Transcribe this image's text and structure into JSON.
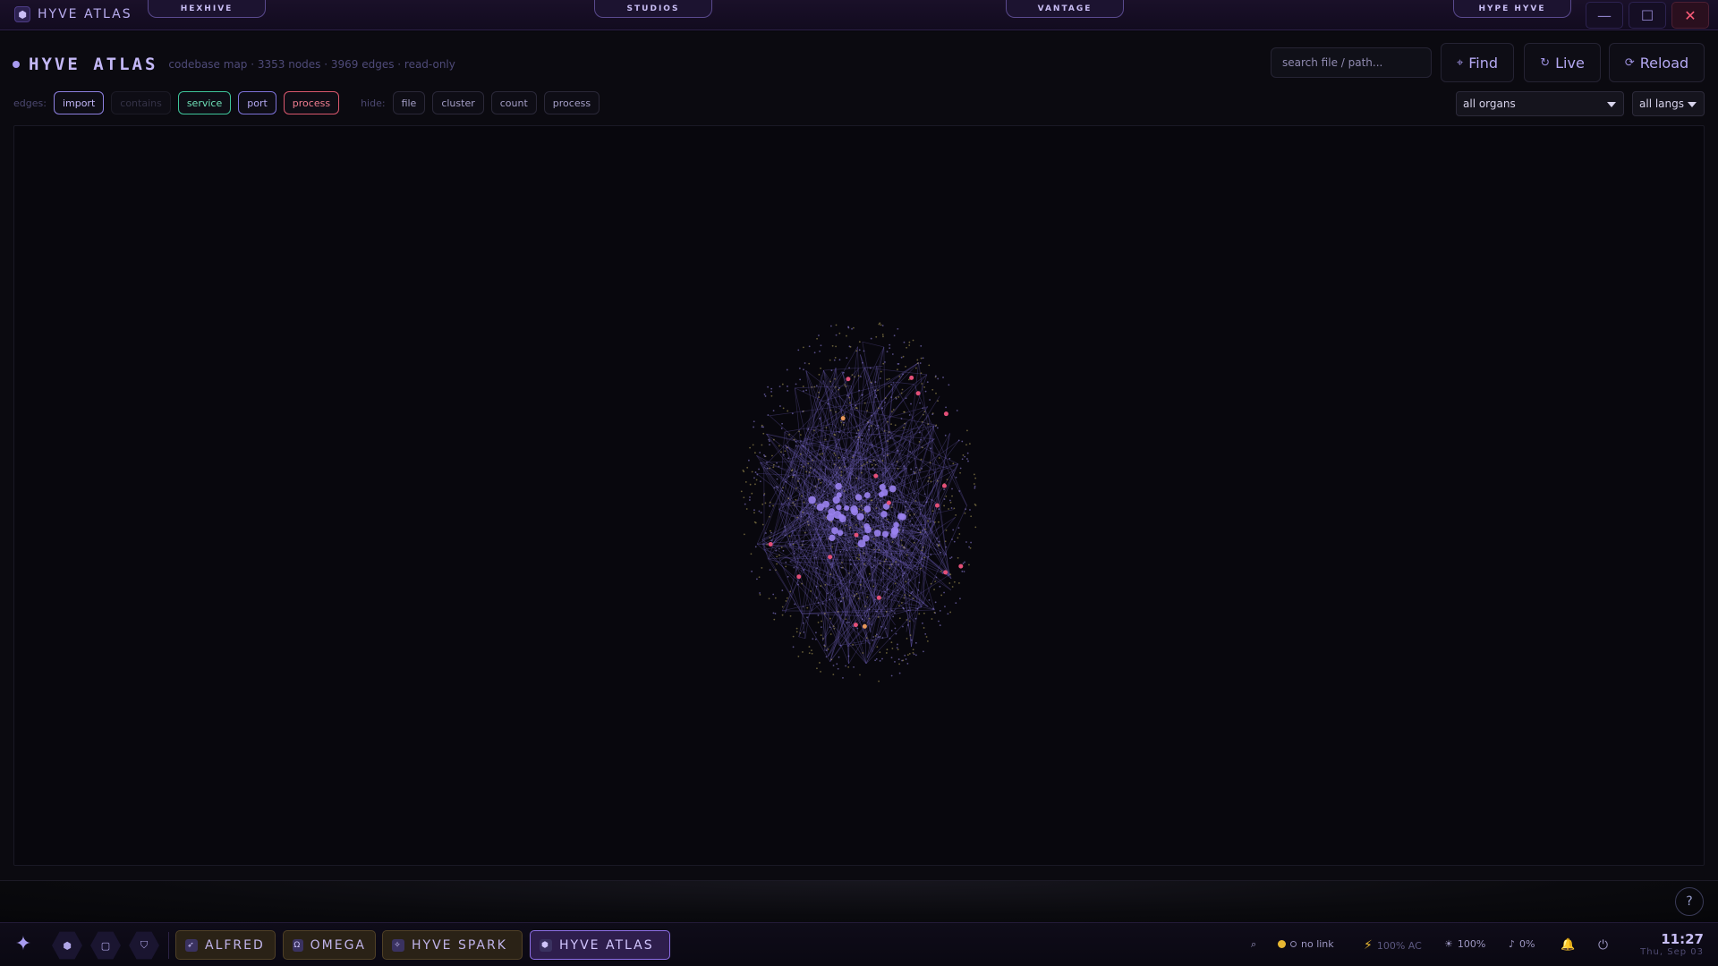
{
  "titlebar": {
    "app_icon": "hexagon-bee-icon",
    "app_name": "HYVE ATLAS",
    "tabs": [
      "HEXHIVE",
      "STUDIOS",
      "VANTAGE",
      "HYPE HYVE"
    ],
    "minimize": "—",
    "maximize": "☐",
    "close": "✕"
  },
  "header": {
    "title": "HYVE ATLAS",
    "meta": "codebase map · 3353 nodes · 3969 edges · read-only",
    "search_placeholder": "search file / path...",
    "find_label": "Find",
    "live_label": "Live",
    "reload_label": "Reload"
  },
  "filters": {
    "edges_label": "edges:",
    "edges": [
      "import",
      "contains",
      "service",
      "port",
      "process"
    ],
    "hide_label": "hide:",
    "hide": [
      "file",
      "cluster",
      "count",
      "process"
    ],
    "organs_select": "all organs",
    "langs_select": "all langs"
  },
  "graph": {
    "node_colors": {
      "core": "#9a82f0",
      "accent": "#e44f78",
      "warm": "#e8965a",
      "edge": "#6d5fb8"
    }
  },
  "strip": {
    "help": "?"
  },
  "taskbar": {
    "logo_icon": "hyve-spark-logo-icon",
    "quick_icons": [
      "bee-icon",
      "window-icon",
      "shield-icon"
    ],
    "tasks": [
      {
        "label": "ALFRED",
        "icon": "rocket-icon",
        "active": false
      },
      {
        "label": "OMEGA",
        "icon": "omega-icon",
        "active": false
      },
      {
        "label": "HYVE SPARK",
        "icon": "spark-icon",
        "active": false
      },
      {
        "label": "HYVE ATLAS",
        "icon": "atlas-icon",
        "active": true
      }
    ],
    "tray": {
      "search_glyph": "⌕",
      "link": "no link",
      "power_glyph": "⚡",
      "battery": "100% AC",
      "brightness_glyph": "☀",
      "brightness": "100%",
      "volume_glyph": "♪",
      "volume": "0%",
      "bell_glyph": "🔔",
      "power_btn_glyph": "⏻"
    },
    "clock": {
      "time": "11:27",
      "date": "Thu, Sep 03"
    }
  }
}
